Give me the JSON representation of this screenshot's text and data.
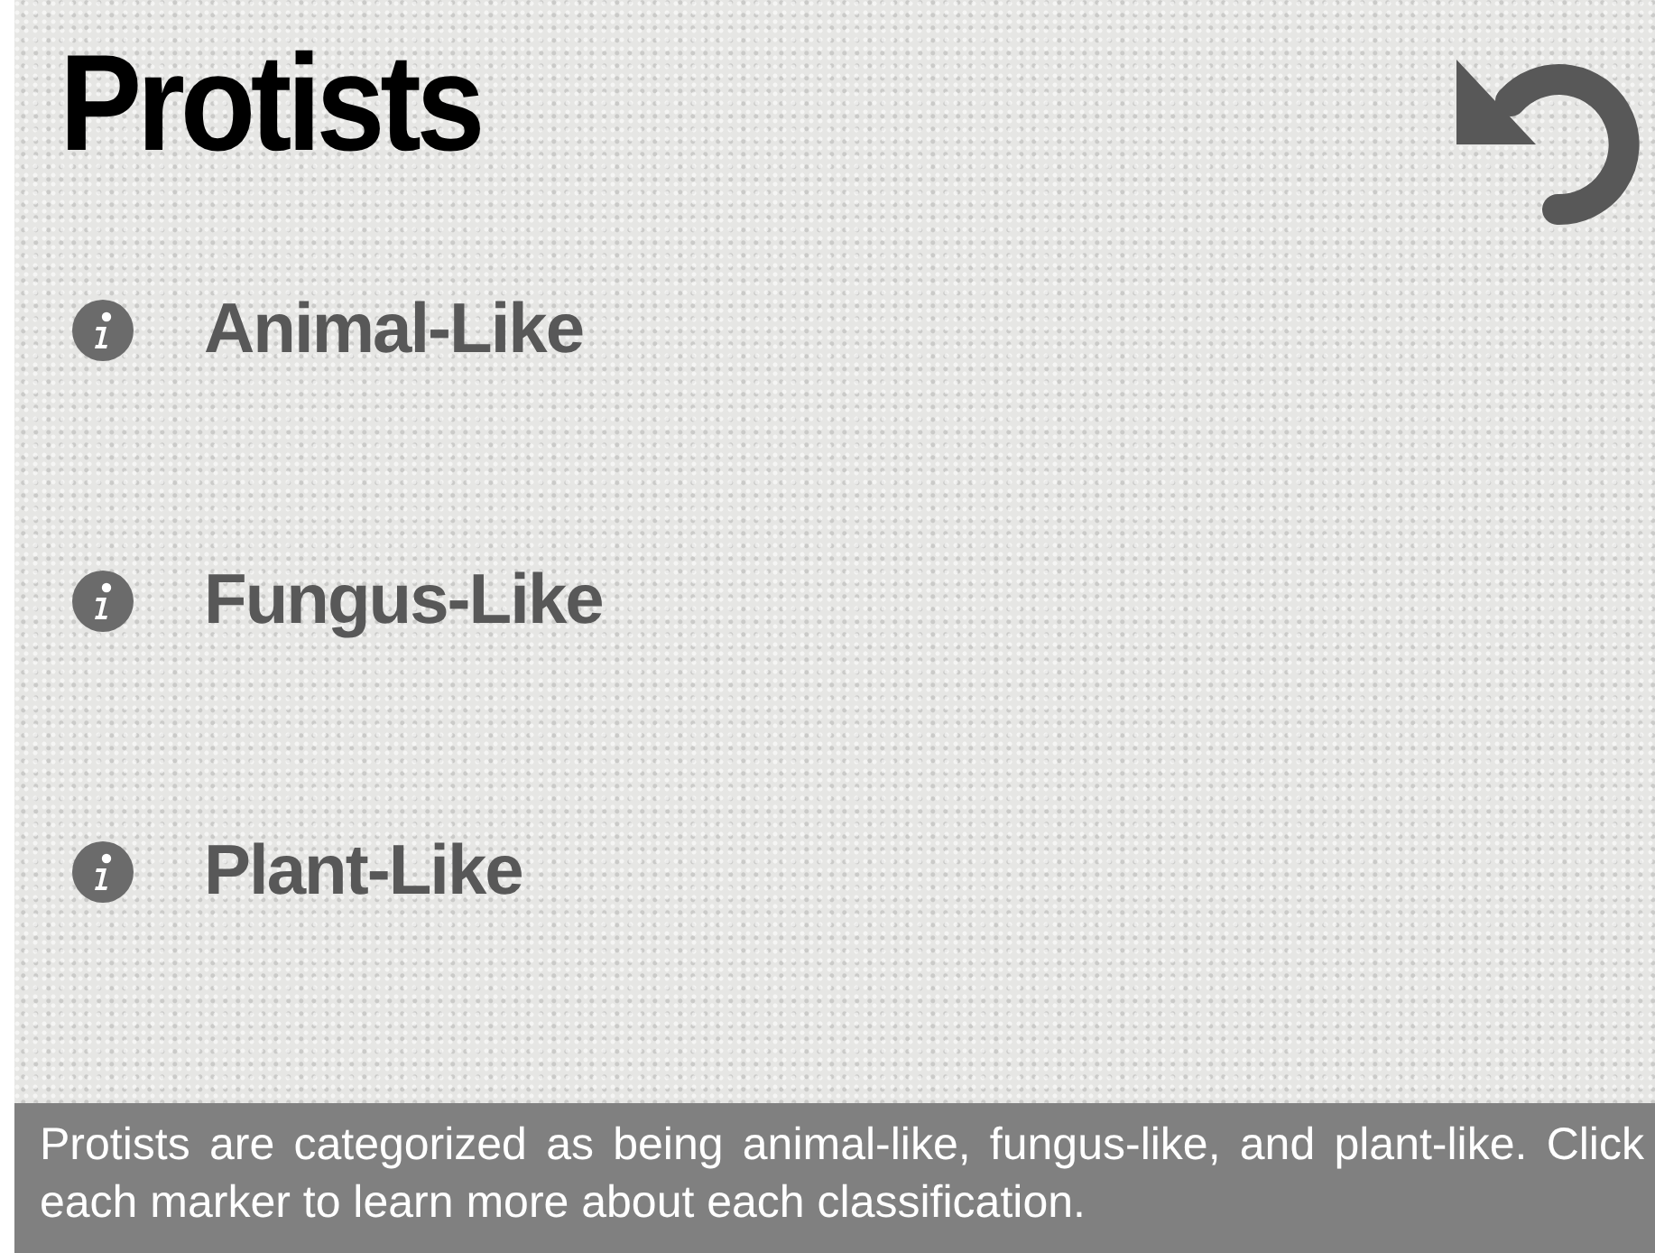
{
  "title": "Protists",
  "markers": [
    {
      "label": "Animal-Like"
    },
    {
      "label": "Fungus-Like"
    },
    {
      "label": "Plant-Like"
    }
  ],
  "caption": "Protists are categorized as being animal-like, fungus-like, and plant-like. Click each marker to learn more about each classification."
}
